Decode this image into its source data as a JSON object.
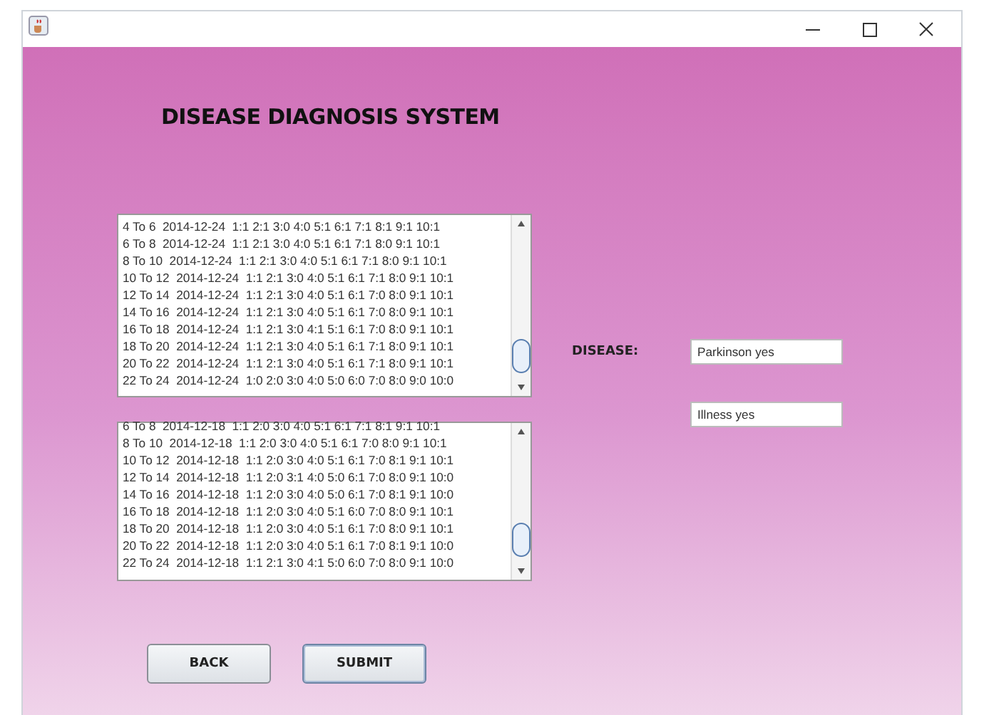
{
  "window": {
    "title_icon": true
  },
  "heading": "DISEASE DIAGNOSIS SYSTEM",
  "log_1": {
    "lines": [
      "4 To 6  2014-12-24  1:1 2:1 3:0 4:0 5:1 6:1 7:1 8:1 9:1 10:1",
      "6 To 8  2014-12-24  1:1 2:1 3:0 4:0 5:1 6:1 7:1 8:0 9:1 10:1",
      "8 To 10  2014-12-24  1:1 2:1 3:0 4:0 5:1 6:1 7:1 8:0 9:1 10:1",
      "10 To 12  2014-12-24  1:1 2:1 3:0 4:0 5:1 6:1 7:1 8:0 9:1 10:1",
      "12 To 14  2014-12-24  1:1 2:1 3:0 4:0 5:1 6:1 7:0 8:0 9:1 10:1",
      "14 To 16  2014-12-24  1:1 2:1 3:0 4:0 5:1 6:1 7:0 8:0 9:1 10:1",
      "16 To 18  2014-12-24  1:1 2:1 3:0 4:1 5:1 6:1 7:0 8:0 9:1 10:1",
      "18 To 20  2014-12-24  1:1 2:1 3:0 4:0 5:1 6:1 7:1 8:0 9:1 10:1",
      "20 To 22  2014-12-24  1:1 2:1 3:0 4:0 5:1 6:1 7:1 8:0 9:1 10:1",
      "22 To 24  2014-12-24  1:0 2:0 3:0 4:0 5:0 6:0 7:0 8:0 9:0 10:0"
    ]
  },
  "log_2": {
    "lines": [
      "6 To 8  2014-12-18  1:1 2:0 3:0 4:0 5:1 6:1 7:1 8:1 9:1 10:1",
      "8 To 10  2014-12-18  1:1 2:0 3:0 4:0 5:1 6:1 7:0 8:0 9:1 10:1",
      "10 To 12  2014-12-18  1:1 2:0 3:0 4:0 5:1 6:1 7:0 8:1 9:1 10:1",
      "12 To 14  2014-12-18  1:1 2:0 3:1 4:0 5:0 6:1 7:0 8:0 9:1 10:0",
      "14 To 16  2014-12-18  1:1 2:0 3:0 4:0 5:0 6:1 7:0 8:1 9:1 10:0",
      "16 To 18  2014-12-18  1:1 2:0 3:0 4:0 5:1 6:0 7:0 8:0 9:1 10:1",
      "18 To 20  2014-12-18  1:1 2:0 3:0 4:0 5:1 6:1 7:0 8:0 9:1 10:1",
      "20 To 22  2014-12-18  1:1 2:0 3:0 4:0 5:1 6:1 7:0 8:1 9:1 10:0",
      "22 To 24  2014-12-18  1:1 2:1 3:0 4:1 5:0 6:0 7:0 8:0 9:1 10:0"
    ]
  },
  "disease_label": "DISEASE:",
  "results": [
    {
      "value": "Parkinson yes"
    },
    {
      "value": "Illness yes"
    }
  ],
  "buttons": [
    {
      "label": "BACK",
      "focused": false
    },
    {
      "label": "SUBMIT",
      "focused": true
    }
  ]
}
